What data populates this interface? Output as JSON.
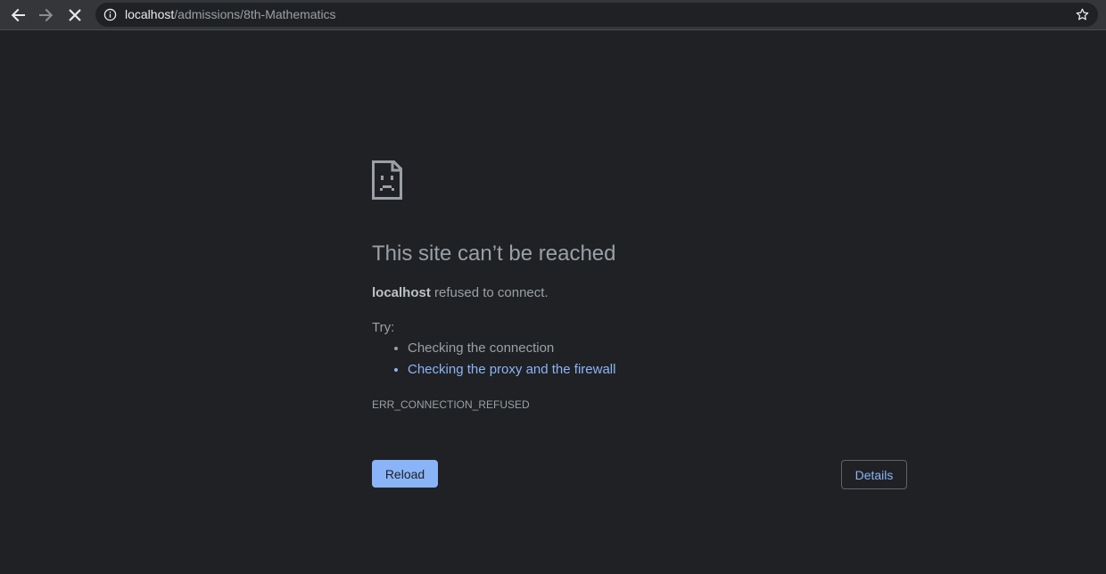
{
  "browser": {
    "url": {
      "host": "localhost",
      "path": "/admissions/8th-Mathematics"
    },
    "icons": {
      "back": "arrow-left-icon",
      "forward": "arrow-right-icon",
      "stop": "close-icon",
      "site_info": "info-circle-icon",
      "bookmark": "star-icon"
    }
  },
  "error_page": {
    "icon": "sad-document-icon",
    "title": "This site can’t be reached",
    "host": "localhost",
    "message": " refused to connect.",
    "try_label": "Try:",
    "suggestions": [
      {
        "text": "Checking the connection",
        "is_link": false
      },
      {
        "text": "Checking the proxy and the firewall",
        "is_link": true
      }
    ],
    "error_code": "ERR_CONNECTION_REFUSED",
    "reload_label": "Reload",
    "details_label": "Details"
  },
  "colors": {
    "background": "#202124",
    "toolbar": "#35363a",
    "text": "#9aa0a6",
    "link": "#8ab4f8",
    "primary_button": "#8ab4f8"
  }
}
